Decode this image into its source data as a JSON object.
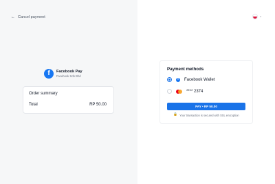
{
  "header": {
    "cancel_label": "Cancel payment",
    "locale": "🇵🇱",
    "locale_chevron": "⌄"
  },
  "merchant": {
    "name": "Facebook Pay",
    "subtitle": "Facebook Sdn Bhd",
    "logo_letter": "f"
  },
  "order_summary": {
    "title": "Order summary",
    "total_label": "Total",
    "total_value": "RP 50.00"
  },
  "payment": {
    "title": "Payment methods",
    "methods": [
      {
        "label": "Facebook Wallet",
        "selected": true,
        "icon": "facebook-icon"
      },
      {
        "label": "**** 2374",
        "selected": false,
        "icon": "mastercard-icon"
      }
    ],
    "pay_button_label": "PAY • RP 50.00",
    "security_note": "Your transaction is secured with SSL encryption",
    "lock_icon": "🔒"
  },
  "colors": {
    "left_panel": "#f6f7f8",
    "right_panel": "#ffffff",
    "primary": "#1a73e8",
    "facebook_blue": "#1877f2"
  }
}
